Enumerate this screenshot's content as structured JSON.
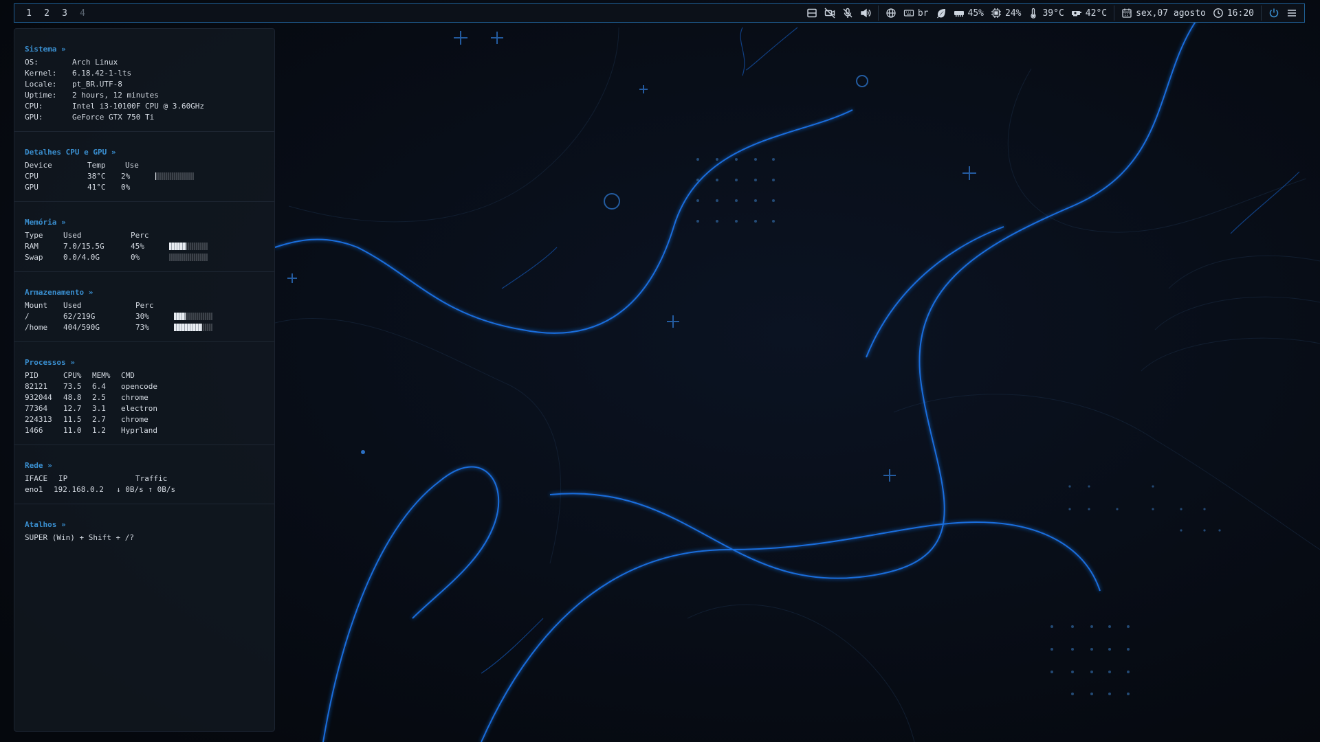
{
  "topbar": {
    "workspaces": [
      "1",
      "2",
      "3",
      "4"
    ],
    "layout": "br",
    "memory_percent": "45%",
    "cpu_percent": "24%",
    "cpu_temp": "39°C",
    "gpu_temp": "42°C",
    "date": "sex,07 agosto",
    "time": "16:20"
  },
  "panel": {
    "sistema": {
      "title": "Sistema »",
      "rows": [
        {
          "label": "OS:",
          "value": "Arch Linux"
        },
        {
          "label": "Kernel:",
          "value": "6.18.42-1-lts"
        },
        {
          "label": "Locale:",
          "value": "pt_BR.UTF-8"
        },
        {
          "label": "Uptime:",
          "value": "2 hours, 12 minutes"
        },
        {
          "label": "CPU:",
          "value": "Intel i3-10100F CPU @ 3.60GHz"
        },
        {
          "label": "GPU:",
          "value": "GeForce GTX 750 Ti"
        }
      ]
    },
    "cpugpu": {
      "title": "Detalhes CPU e GPU »",
      "headers": [
        "Device",
        "Temp",
        "Use"
      ],
      "rows": [
        {
          "device": "CPU",
          "temp": "38°C",
          "use": "2%",
          "use_fraction": 0.02
        },
        {
          "device": "GPU",
          "temp": "41°C",
          "use": "0%"
        }
      ]
    },
    "memoria": {
      "title": "Memória »",
      "headers": [
        "Type",
        "Used",
        "Perc"
      ],
      "rows": [
        {
          "type": "RAM",
          "used": "7.0/15.5G",
          "perc": "45%",
          "fraction": 0.45
        },
        {
          "type": "Swap",
          "used": "0.0/4.0G",
          "perc": "0%",
          "fraction": 0.0
        }
      ]
    },
    "armazenamento": {
      "title": "Armazenamento »",
      "headers": [
        "Mount",
        "Used",
        "Perc"
      ],
      "rows": [
        {
          "mount": "/",
          "used": "62/219G",
          "perc": "30%",
          "fraction": 0.3
        },
        {
          "mount": "/home",
          "used": "404/590G",
          "perc": "73%",
          "fraction": 0.73
        }
      ]
    },
    "processos": {
      "title": "Processos »",
      "headers": [
        "PID",
        "CPU%",
        "MEM%",
        "CMD"
      ],
      "rows": [
        {
          "pid": "82121",
          "cpu": "73.5",
          "mem": "6.4",
          "cmd": "opencode"
        },
        {
          "pid": "932044",
          "cpu": "48.8",
          "mem": "2.5",
          "cmd": "chrome"
        },
        {
          "pid": "77364",
          "cpu": "12.7",
          "mem": "3.1",
          "cmd": "electron"
        },
        {
          "pid": "224313",
          "cpu": "11.5",
          "mem": "2.7",
          "cmd": "chrome"
        },
        {
          "pid": "1466",
          "cpu": "11.0",
          "mem": "1.2",
          "cmd": "Hyprland"
        }
      ]
    },
    "rede": {
      "title": "Rede »",
      "headers": [
        "IFACE",
        "IP",
        "Traffic"
      ],
      "rows": [
        {
          "iface": "eno1",
          "ip": "192.168.0.2",
          "traffic": "↓ 0B/s ↑ 0B/s"
        }
      ]
    },
    "atalhos": {
      "title": "Atalhos »",
      "text": "SUPER (Win) + Shift + /?"
    }
  },
  "colors": {
    "accent": "#3a8fd0",
    "bar_border": "#1f5e93",
    "wallpaper_bg": "#070b12",
    "wave_glow": "#1e7fff"
  }
}
